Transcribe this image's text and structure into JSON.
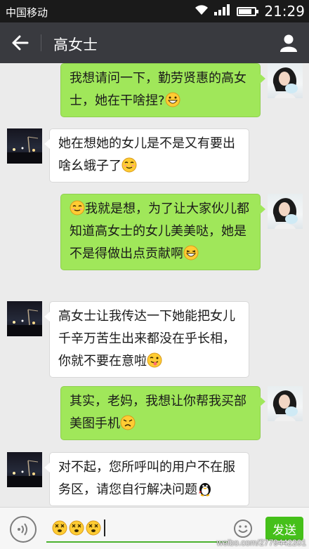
{
  "status_bar": {
    "carrier": "中国移动",
    "time": "21:29",
    "battery_level": 0.8
  },
  "header": {
    "title": "高女士"
  },
  "messages": [
    {
      "sender": "self",
      "text": "我想请问一下，勤劳贤惠的高女士，她在干啥捏?",
      "emoji": "grinning-emoji"
    },
    {
      "sender": "other",
      "text": "她在想她的女儿是不是又有要出啥幺蛾子了",
      "emoji": "winking-emoji"
    },
    {
      "sender": "self",
      "lead_emoji": "smiling-emoji",
      "text": "我就是想，为了让大家伙儿都知道高女士的女儿美美哒，她是不是得做出点贡献啊",
      "emoji": "laughing-emoji"
    },
    {
      "sender": "other",
      "text": "高女士让我传达一下她能把女儿千辛万苦生出来都没在乎长相，你就不要在意啦",
      "emoji": "tongue-wink-emoji"
    },
    {
      "sender": "self",
      "text": "其实，老妈，我想让你帮我买部美图手机",
      "emoji": "sad-emoji"
    },
    {
      "sender": "other",
      "text": "对不起，您所呼叫的用户不在服务区，请您自行解决问题",
      "emoji": "penguin-emoji"
    }
  ],
  "input": {
    "draft_emojis": [
      "dizzy-emoji",
      "dizzy-emoji",
      "dizzy-emoji"
    ],
    "send_label": "发送"
  },
  "watermark": "weibo.com/2779442201",
  "colors": {
    "header": "#393a3f",
    "self_bubble": "#a0e75a",
    "other_bubble": "#ffffff",
    "send_button": "#45c01a",
    "background": "#ebebeb"
  }
}
